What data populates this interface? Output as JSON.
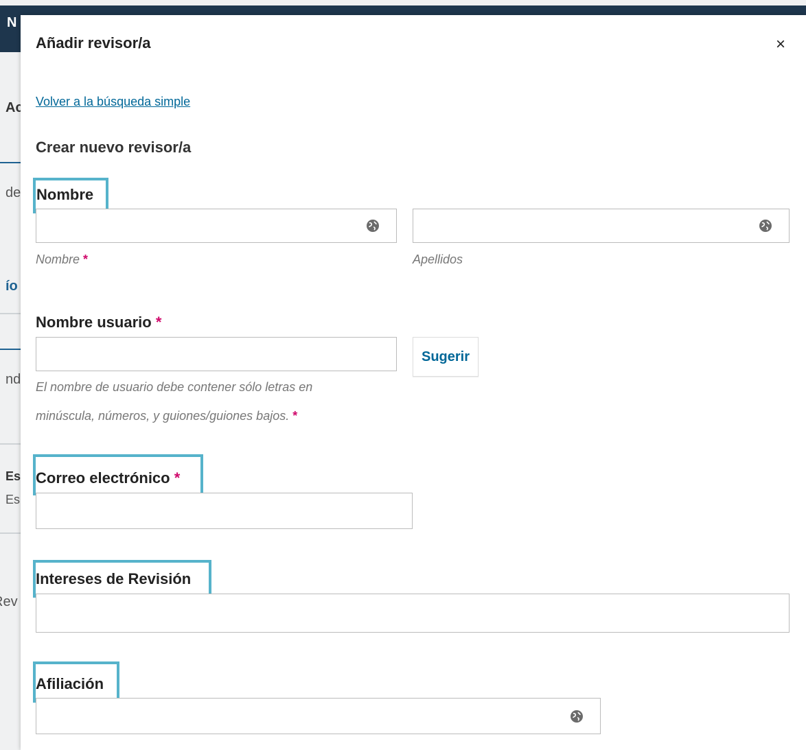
{
  "background": {
    "brand": "N",
    "fragments": [
      "Ac",
      "de",
      "ío",
      "nd",
      "Es",
      "Es",
      "Rev"
    ]
  },
  "modal": {
    "title": "Añadir revisor/a",
    "close_icon": "×",
    "back_link": "Volver a la búsqueda simple",
    "section_title": "Crear nuevo revisor/a",
    "name": {
      "label": "Nombre",
      "first_name": {
        "value": "",
        "help": "Nombre",
        "icon": "globe-icon"
      },
      "last_name": {
        "value": "",
        "help": "Apellidos",
        "icon": "globe-icon"
      }
    },
    "username": {
      "label": "Nombre usuario",
      "value": "",
      "suggest_button": "Sugerir",
      "help_line1": "El nombre de usuario debe contener sólo letras en",
      "help_line2": "minúscula, números, y guiones/guiones bajos."
    },
    "email": {
      "label": "Correo electrónico",
      "value": ""
    },
    "interests": {
      "label": "Intereses de Revisión",
      "value": ""
    },
    "affiliation": {
      "label": "Afiliación",
      "value": "",
      "icon": "globe-icon"
    },
    "required_mark": "*"
  },
  "colors": {
    "accent": "#006798",
    "required": "#d00a6c",
    "highlight": "#56b3cb",
    "topbar": "#1e364d"
  }
}
